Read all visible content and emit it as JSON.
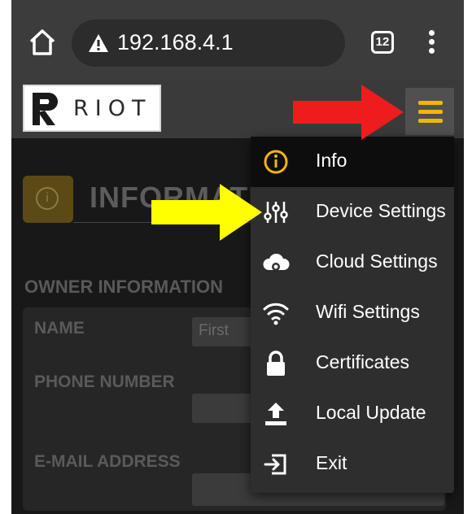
{
  "browser": {
    "url": "192.168.4.1",
    "tab_count": "12"
  },
  "header": {
    "logo_text": "RIOT"
  },
  "page": {
    "title": "INFORMATI",
    "section_heading": "OWNER INFORMATION",
    "fields": [
      {
        "label": "NAME",
        "placeholder": "First"
      },
      {
        "label": "PHONE NUMBER",
        "placeholder": ""
      },
      {
        "label": "E-MAIL ADDRESS",
        "placeholder": ""
      }
    ]
  },
  "menu": {
    "items": [
      {
        "label": "Info",
        "icon": "info-icon",
        "active": true
      },
      {
        "label": "Device Settings",
        "icon": "sliders-icon",
        "active": false
      },
      {
        "label": "Cloud Settings",
        "icon": "cloud-gear-icon",
        "active": false
      },
      {
        "label": "Wifi Settings",
        "icon": "wifi-icon",
        "active": false
      },
      {
        "label": "Certificates",
        "icon": "lock-icon",
        "active": false
      },
      {
        "label": "Local Update",
        "icon": "upload-icon",
        "active": false
      },
      {
        "label": "Exit",
        "icon": "exit-icon",
        "active": false
      }
    ]
  },
  "colors": {
    "accent": "#f2b705",
    "red_arrow": "#ee1c1c",
    "yellow_arrow": "#ffff00",
    "menu_bg": "#2e2e2e",
    "active_item_bg": "#0d0d0d"
  }
}
